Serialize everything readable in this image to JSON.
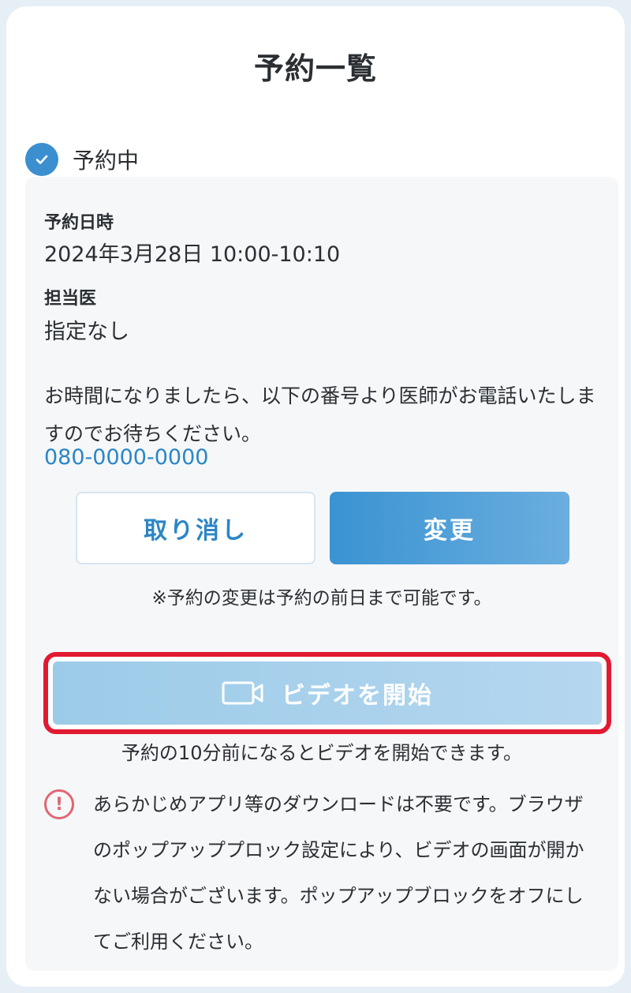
{
  "header": {
    "title": "予約一覧"
  },
  "reservation": {
    "status_label": "予約中",
    "datetime_label": "予約日時",
    "datetime_value": "2024年3月28日 10:00-10:10",
    "doctor_label": "担当医",
    "doctor_value": "指定なし",
    "notice": "お時間になりましたら、以下の番号より医師がお電話いたしますのでお待ちください。",
    "phone": "080-0000-0000"
  },
  "actions": {
    "cancel_label": "取り消し",
    "change_label": "変更",
    "change_note": "※予約の変更は予約の前日まで可能です。"
  },
  "video": {
    "start_label": "ビデオを開始",
    "note": "予約の10分前になるとビデオを開始できます。"
  },
  "warning": {
    "text": "あらかじめアプリ等のダウンロードは不要です。ブラウザのポップアッププロック設定により、ビデオの画面が開かない場合がございます。ポップアップブロックをオフにしてご利用ください。"
  },
  "colors": {
    "accent": "#3b8fcf",
    "link": "#2b86c5",
    "highlight_border": "#e11a32",
    "warning": "#e06672"
  },
  "icons": {
    "status": "check-circle-icon",
    "video": "video-camera-icon",
    "warning": "exclamation-circle-icon"
  }
}
